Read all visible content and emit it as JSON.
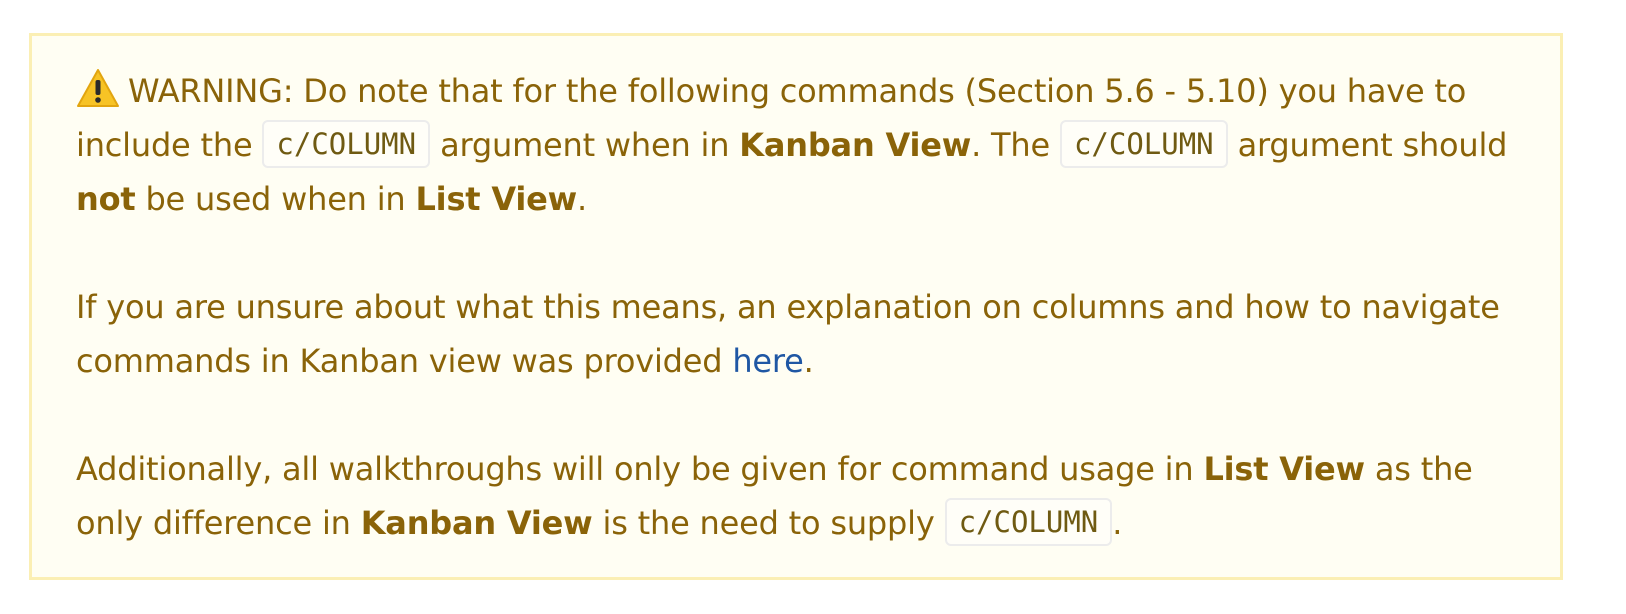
{
  "warning": {
    "icon": "warning-icon",
    "p1": {
      "t1": "WARNING: Do note that for the following commands (Section 5.6 - 5.10) you have to include the ",
      "code1": "c/COLUMN",
      "t2": " argument when in ",
      "b1": "Kanban View",
      "t3": ". The ",
      "code2": "c/COLUMN",
      "t4": " argument should ",
      "b2": "not",
      "t5": " be used when in ",
      "b3": "List View",
      "t6": "."
    },
    "p2": {
      "t1": "If you are unsure about what this means, an explanation on columns and how to navigate commands in Kanban view was provided ",
      "link": "here",
      "t2": "."
    },
    "p3": {
      "t1": "Additionally, all walkthroughs will only be given for command usage in ",
      "b1": "List View",
      "t2": " as the only difference in ",
      "b2": "Kanban View",
      "t3": " is the need to supply ",
      "code1": "c/COLUMN",
      "t4": "."
    }
  },
  "colors": {
    "text": "#8a6308",
    "border": "#fbefb4",
    "background": "#fffef3",
    "link": "#1f57a4"
  }
}
